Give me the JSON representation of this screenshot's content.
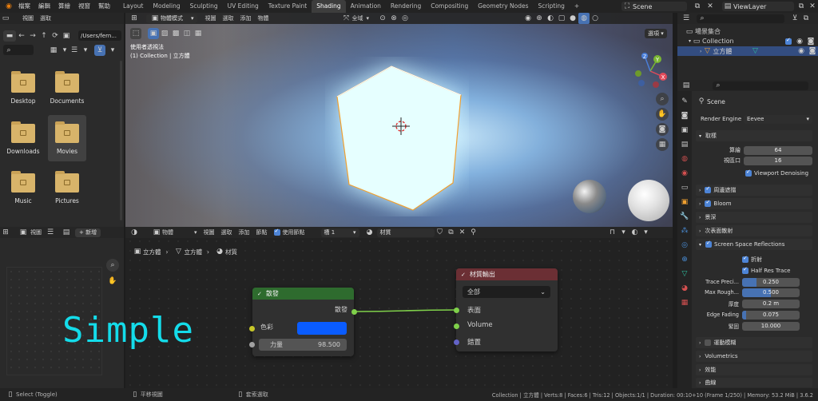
{
  "topbar": {
    "menus": [
      "檔案",
      "編輯",
      "算繪",
      "視窗",
      "幫助"
    ],
    "tabs": [
      "Layout",
      "Modeling",
      "Sculpting",
      "UV Editing",
      "Texture Paint",
      "Shading",
      "Animation",
      "Rendering",
      "Compositing",
      "Geometry Nodes",
      "Scripting"
    ],
    "active_tab": "Shading",
    "add_tab": "+",
    "scene": "Scene",
    "view_layer": "ViewLayer"
  },
  "file_browser": {
    "header_items": [
      "視圖",
      "選取"
    ],
    "path": "/Users/fern...",
    "folders": [
      "Desktop",
      "Documents",
      "Downloads",
      "Movies",
      "Music",
      "Pictures"
    ]
  },
  "viewport": {
    "mode": "物體模式",
    "menus": [
      "視圖",
      "選取",
      "添加",
      "物體"
    ],
    "transform_orientation": "全域",
    "options": "選項",
    "info_line1": "使用者透視法",
    "info_line2": "(1) Collection | 立方體",
    "gizmo": {
      "x": "X",
      "y": "Y",
      "z": "Z"
    },
    "colors": {
      "x": "#e04a5a",
      "y": "#7ab632",
      "z": "#4a7ed8",
      "selection": "#f0a030"
    }
  },
  "image_editor": {
    "menus": [
      "視圖",
      "新增"
    ]
  },
  "node_editor": {
    "type": "物體",
    "menus": [
      "視圖",
      "選取",
      "添加",
      "節點"
    ],
    "use_nodes": "使用節點",
    "slot": "槽 1",
    "material": "材質",
    "breadcrumb": [
      "立方體",
      "立方體",
      "材質"
    ],
    "emission_node": {
      "title": "散發",
      "output": "散發",
      "color_label": "色彩",
      "color": "#0a5cff",
      "strength_label": "力量",
      "strength_value": "98.500"
    },
    "output_node": {
      "title": "材質輸出",
      "target": "全部",
      "inputs": [
        "表面",
        "Volume",
        "錯置"
      ]
    },
    "watermark": "Simple"
  },
  "outliner": {
    "root": "場景集合",
    "collection": "Collection",
    "object": "立方體"
  },
  "properties": {
    "scene_name": "Scene",
    "render_engine_label": "Render Engine",
    "render_engine": "Eevee",
    "sampling": {
      "title": "取樣",
      "render_label": "算繪",
      "render_value": "64",
      "viewport_label": "視區口",
      "viewport_value": "16",
      "denoise": "Viewport Denoising"
    },
    "sections": [
      "周邊遮擋",
      "Bloom",
      "景深",
      "次表面散射",
      "Screen Space Reflections"
    ],
    "ssr": {
      "refraction": "折射",
      "half_res": "Half Res Trace",
      "fields": [
        {
          "label": "Trace Preci...",
          "value": "0.250",
          "fill": 0.25
        },
        {
          "label": "Max Rough...",
          "value": "0.500",
          "fill": 0.5
        },
        {
          "label": "厚度",
          "value": "0.2 m",
          "fill": 0
        },
        {
          "label": "Edge Fading",
          "value": "0.075",
          "fill": 0.075
        },
        {
          "label": "緊固",
          "value": "10.000",
          "fill": 0
        }
      ]
    },
    "more_sections": [
      "運動模糊",
      "Volumetrics",
      "效能",
      "曲線"
    ]
  },
  "status": {
    "left1": "Select (Toggle)",
    "left2": "平移視圖",
    "left3": "套索選取",
    "right": "Collection | 立方體 | Verts:8 | Faces:6 | Tris:12 | Objects:1/1 | Duration: 00:10+10 (Frame 1/250) | Memory: 53.2 MiB | 3.6.2"
  }
}
